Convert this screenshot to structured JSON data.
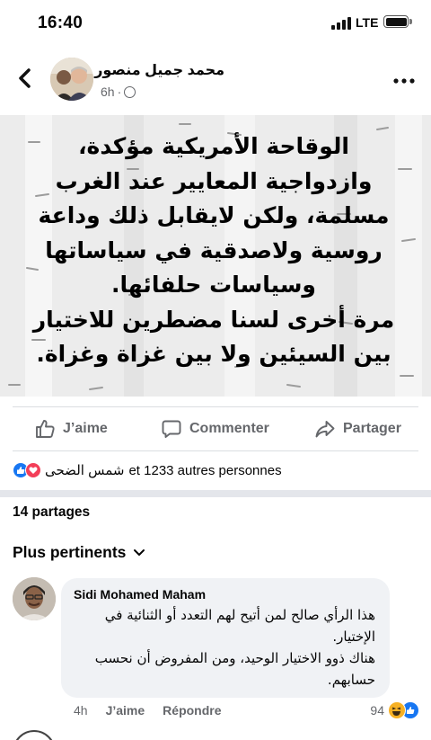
{
  "status_bar": {
    "time": "16:40",
    "network": "LTE"
  },
  "post": {
    "author": "محمد جميل منصور",
    "time": "6h",
    "separator": "·",
    "body": "الوقاحة الأمريكية مؤكدة،\nوازدواجية المعايير عند الغرب\nمسلمة، ولكن لايقابل ذلك وداعة\nروسية ولاصدقية في سياساتها\nوسياسات حلفائها.\nمرة أخرى لسنا مضطرين للاختيار\nبين السيئين ولا بين غزاة وغزاة."
  },
  "actions": {
    "like": "J’aime",
    "comment": "Commenter",
    "share": "Partager"
  },
  "reactions": {
    "first_name": "شمس الضحى",
    "others": "et 1233 autres personnes"
  },
  "shares": "14 partages",
  "sort_label": "Plus pertinents",
  "comment": {
    "author": "Sidi Mohamed Maham",
    "text": "هذا الرأي صالح لمن أتيح لهم التعدد أو الثنائية في\nالإختيار.\nهناك ذوو الاختيار الوحيد، ومن المفروض أن نحسب\nحسابهم.",
    "time": "4h",
    "like": "J’aime",
    "reply": "Répondre",
    "reaction_count": "94"
  },
  "colors": {
    "accent": "#1877f2",
    "love": "#f33e58",
    "haha": "#f7b125",
    "muted": "#65676b"
  },
  "icons": [
    "back-icon",
    "more-icon",
    "globe-icon",
    "like-icon",
    "comment-icon",
    "share-icon",
    "chevron-down-icon"
  ]
}
